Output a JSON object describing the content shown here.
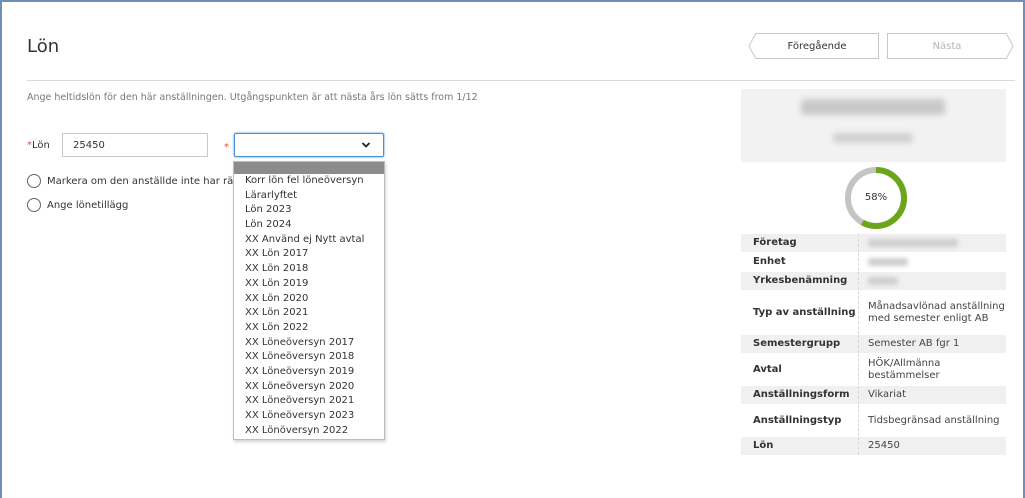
{
  "header": {
    "title": "Lön",
    "prev_label": "Föregående",
    "next_label": "Nästa"
  },
  "form": {
    "description": "Ange heltidslön för den här anställningen. Utgångspunkten är att nästa års lön sätts from 1/12",
    "required_mark": "*",
    "lon_label": "Lön",
    "lon_value": "25450",
    "select_value": "",
    "dropdown_options": [
      "Korr lön fel löneöversyn",
      "Lärarlyftet",
      "Lön 2023",
      "Lön 2024",
      "XX Använd ej Nytt avtal",
      "XX Lön 2017",
      "XX Lön 2018",
      "XX Lön 2019",
      "XX Lön 2020",
      "XX Lön 2021",
      "XX Lön 2022",
      "XX Löneöversyn 2017",
      "XX Löneöversyn 2018",
      "XX Löneöversyn 2019",
      "XX Löneöversyn 2020",
      "XX Löneöversyn 2021",
      "XX Löneöversyn 2023",
      "XX Lönöversyn 2022"
    ],
    "checkbox_1_label": "Markera om den anställde inte har rätt",
    "checkbox_2_label": "Ange lönetillägg"
  },
  "sidebar": {
    "progress_percent": 58,
    "progress_label": "58%",
    "colors": {
      "progress": "#6aa51a",
      "track": "#c4c4c4"
    },
    "info": [
      {
        "key": "Företag",
        "value": "",
        "blurred": true
      },
      {
        "key": "Enhet",
        "value": "",
        "blurred": true
      },
      {
        "key": "Yrkesbenämning",
        "value": "",
        "blurred": true
      },
      {
        "key": "Typ av anställning",
        "value": "Månadsavlönad anställning med semester enligt AB"
      },
      {
        "key": "Semestergrupp",
        "value": "Semester AB fgr 1"
      },
      {
        "key": "Avtal",
        "value": "HÖK/Allmänna bestämmelser"
      },
      {
        "key": "Anställningsform",
        "value": "Vikariat"
      },
      {
        "key": "Anställningstyp",
        "value": "Tidsbegränsad anställning"
      },
      {
        "key": "Lön",
        "value": "25450"
      }
    ]
  }
}
